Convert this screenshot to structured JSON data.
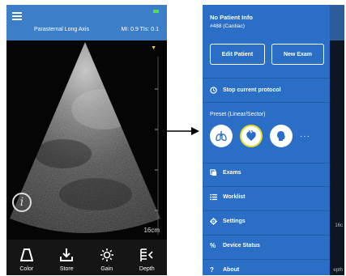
{
  "left_screen": {
    "header": {
      "view_label": "Parasternal Long Axis",
      "indices": "MI: 0.9  TIs: 0.1"
    },
    "scan": {
      "depth_label": "16cm",
      "depth_marker_icon": "chevron-down-icon"
    },
    "toolbar": [
      {
        "label": "Color",
        "icon": "color-doppler-icon"
      },
      {
        "label": "Store",
        "icon": "download-icon"
      },
      {
        "label": "Gain",
        "icon": "sun-icon"
      },
      {
        "label": "Depth",
        "icon": "depth-icon"
      }
    ],
    "colors": {
      "header": "#3d7ec8",
      "battery": "#4ee24e",
      "toolbar": "#151515"
    }
  },
  "right_screen": {
    "patient": {
      "title": "No Patient Info",
      "subtitle": "#488 (Cardiac)"
    },
    "buttons": {
      "edit_patient": "Edit Patient",
      "new_exam": "New Exam"
    },
    "stop_protocol": "Stop current protocol",
    "preset": {
      "label": "Preset (Linear/Sector)",
      "icons": [
        "lungs-icon",
        "heart-icon",
        "head-icon"
      ],
      "selected": "heart-icon",
      "more": "···"
    },
    "menu": [
      {
        "label": "Exams",
        "icon": "exams-icon"
      },
      {
        "label": "Worklist",
        "icon": "list-icon"
      },
      {
        "label": "Settings",
        "icon": "gear-icon"
      },
      {
        "label": "Device Status",
        "icon": "percent-icon"
      },
      {
        "label": "About",
        "icon": "question-icon"
      }
    ],
    "underlay": {
      "depth_fragment": "16c",
      "label_fragment": "epth"
    },
    "colors": {
      "drawer": "#2a6fc5",
      "selected_ring": "#e4dc2a"
    }
  }
}
